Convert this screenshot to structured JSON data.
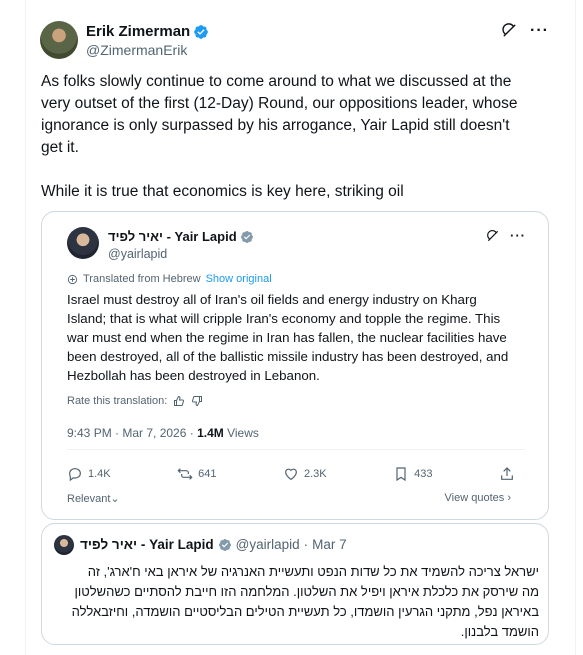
{
  "post": {
    "display_name": "Erik Zimerman",
    "handle": "@ZimermanErik",
    "paragraphs": [
      "As folks slowly continue to come around to what we discussed at the very outset of the first (12-Day) Round, our oppositions leader, whose ignorance is only surpassed by his arrogance, Yair Lapid still doesn't get it.",
      "While it is true that economics is key here, striking oil"
    ],
    "more_label": "···"
  },
  "quote": {
    "display_name": "יאיר לפיד - Yair Lapid",
    "handle": "@yairlapid",
    "translated_label": "Translated from Hebrew",
    "show_original": "Show original",
    "text": "Israel must destroy all of Iran's oil fields and energy industry on Kharg Island; that is what will cripple Iran's economy and topple the regime. This war must end when the regime in Iran has fallen, the nuclear facilities have been destroyed, all of the ballistic missile industry has been destroyed, and Hezbollah has been destroyed in Lebanon.",
    "rate_label": "Rate this translation:",
    "timestamp": "9:43 PM · Mar 7, 2026 · ",
    "views_count": "1.4M",
    "views_label": " Views",
    "replies": "1.4K",
    "reposts": "641",
    "likes": "2.3K",
    "bookmarks": "433",
    "relevant_label": "Relevant",
    "view_quotes_label": "View quotes"
  },
  "embedded": {
    "display_name": "יאיר לפיד - Yair Lapid",
    "handle": "@yairlapid",
    "separator": "·",
    "date": "Mar 7",
    "text": "ישראל צריכה להשמיד את כל שדות הנפט ותעשיית האנרגיה של איראן באי ח'ארג', זה מה שירסק את כלכלת איראן ויפיל את השלטון. המלחמה הזו חייבת להסתיים כשהשלטון באיראן נפל, מתקני הגרעין הושמדו, כל תעשיית הטילים הבליסטיים הושמדה, וחיזבאללה הושמד בלבנון."
  },
  "colors": {
    "verified": "#1d9bf0",
    "link": "#1d9bf0",
    "text": "#0f1419",
    "secondary": "#536471",
    "border": "#cfd9de"
  }
}
